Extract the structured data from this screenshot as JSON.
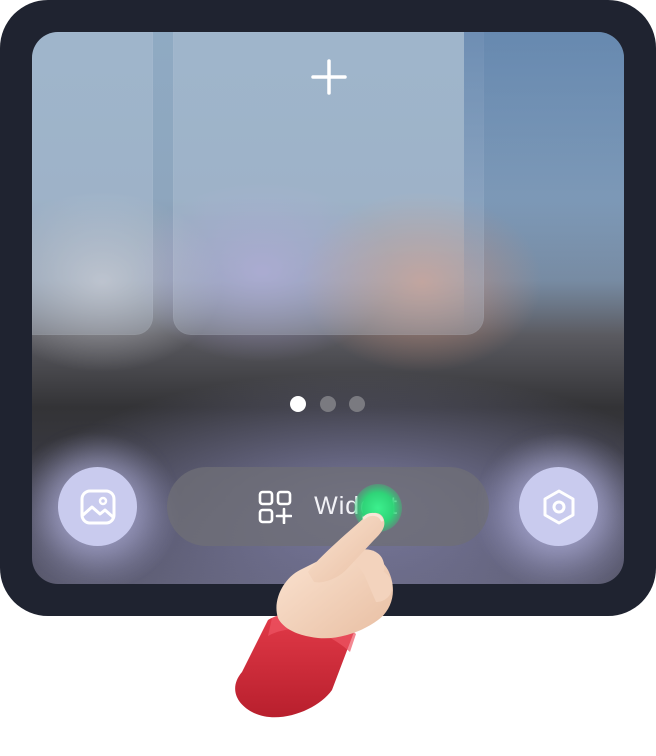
{
  "screen": {
    "add_label": "+",
    "pages": {
      "count": 3,
      "active_index": 0
    },
    "dock": {
      "gallery_icon": "image-icon",
      "widget_label": "Widget",
      "widget_icon": "grid-add-icon",
      "settings_icon": "hexagon-settings-icon"
    }
  },
  "colors": {
    "device_frame": "#1f2330",
    "button_lilac": "#c9cbee",
    "touch_indicator": "#3ce890",
    "sleeve": "#d62b3a"
  }
}
